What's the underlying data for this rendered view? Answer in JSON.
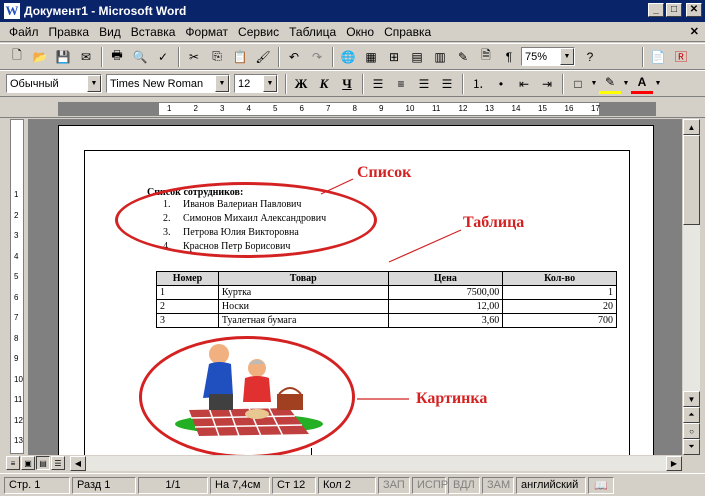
{
  "window": {
    "title": "Документ1 - Microsoft Word",
    "app_icon": "W"
  },
  "menu": [
    "Файл",
    "Правка",
    "Вид",
    "Вставка",
    "Формат",
    "Сервис",
    "Таблица",
    "Окно",
    "Справка"
  ],
  "toolbar": {
    "zoom": "75%",
    "style": "Обычный",
    "font": "Times New Roman",
    "size": "12",
    "bold": "Ж",
    "italic": "К",
    "underline": "Ч"
  },
  "ruler": {
    "h_marks": [
      "1",
      "2",
      "3",
      "4",
      "5",
      "6",
      "7",
      "8",
      "9",
      "10",
      "11",
      "12",
      "13",
      "14",
      "15",
      "16",
      "17"
    ],
    "v_marks": [
      "1",
      "2",
      "3",
      "4",
      "5",
      "6",
      "7",
      "8",
      "9",
      "10",
      "11",
      "12",
      "13"
    ]
  },
  "document": {
    "list_heading": "Список сотрудников:",
    "employees": [
      {
        "n": "1.",
        "name": "Иванов Валериан Павлович"
      },
      {
        "n": "2.",
        "name": "Симонов Михаил Александрович"
      },
      {
        "n": "3.",
        "name": "Петрова Юлия Викторовна"
      },
      {
        "n": "4.",
        "name": "Краснов Петр Борисович"
      }
    ],
    "table": {
      "headers": [
        "Номер",
        "Товар",
        "Цена",
        "Кол-во"
      ],
      "rows": [
        [
          "1",
          "Куртка",
          "7500,00",
          "1"
        ],
        [
          "2",
          "Носки",
          "12,00",
          "20"
        ],
        [
          "3",
          "Туалетная бумага",
          "3,60",
          "700"
        ]
      ]
    },
    "callouts": {
      "list": "Список",
      "table": "Таблица",
      "picture": "Картинка"
    }
  },
  "status": {
    "page": "Стр. 1",
    "section": "Разд 1",
    "pages": "1/1",
    "at": "На 7,4см",
    "line": "Ст 12",
    "col": "Кол 2",
    "rec": "ЗАП",
    "trk": "ИСПР",
    "ext": "ВДЛ",
    "ovr": "ЗАМ",
    "lang": "английский"
  },
  "colors": {
    "accent": "#d42222",
    "titlebar": "#0a246a"
  }
}
